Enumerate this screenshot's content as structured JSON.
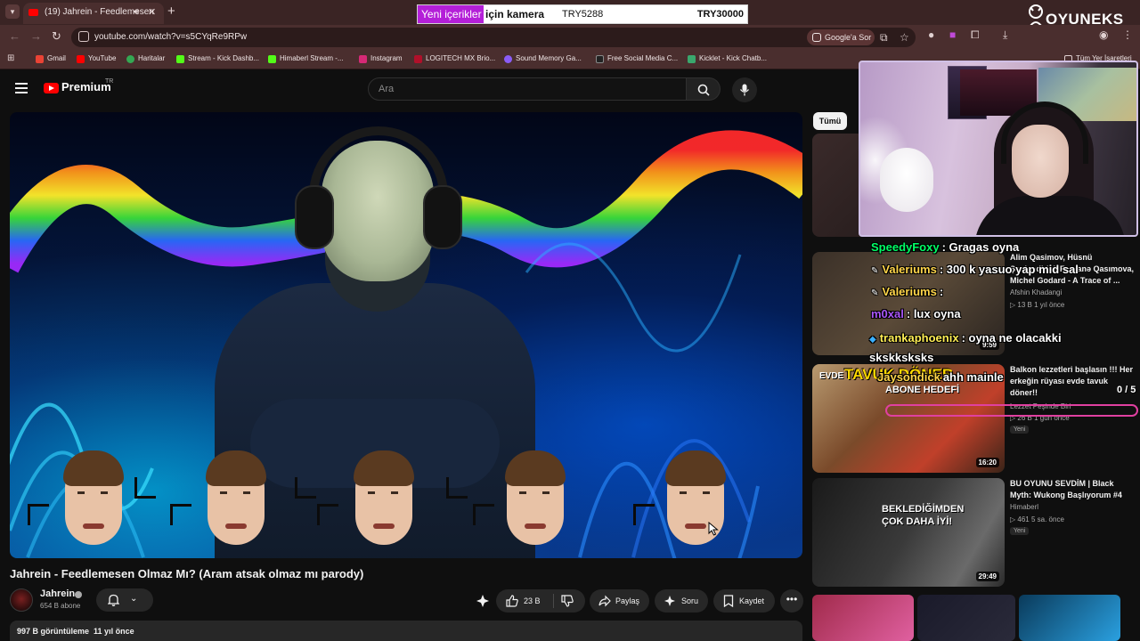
{
  "browser": {
    "tab_title": "(19) Jahrein - Feedlemesen",
    "address": "youtube.com/watch?v=s5CYqRe9RPw",
    "lens_label": "Google'a Sor",
    "bookmarks": [
      {
        "label": "Gmail",
        "color": "#ea4335"
      },
      {
        "label": "YouTube",
        "color": "#ff0000"
      },
      {
        "label": "Haritalar",
        "color": "#34a853"
      },
      {
        "label": "Stream - Kick Dashb...",
        "color": "#53fc18"
      },
      {
        "label": "Himaberl Stream -...",
        "color": "#53fc18"
      },
      {
        "label": "Instagram",
        "color": "#d62976"
      },
      {
        "label": "LOGITECH MX Brio...",
        "color": "#b0102a"
      },
      {
        "label": "Sound Memory Ga...",
        "color": "#8a5cf6"
      },
      {
        "label": "Free Social Media C...",
        "color": "#222222"
      },
      {
        "label": "Kicklet - Kick Chatb...",
        "color": "#3aa76d"
      }
    ],
    "bookmarks_other": "Tüm Yer İşaretleri"
  },
  "donation": {
    "new_content": "Yeni içerikler",
    "goal_label": "için kamera",
    "current": "TRY5288",
    "target": "TRY30000"
  },
  "logo": {
    "text": "OYUNEKS"
  },
  "youtube": {
    "brand": "Premium",
    "country": "TR",
    "search_placeholder": "Ara",
    "video": {
      "title": "Jahrein - Feedlemesen Olmaz Mı? (Aram atsak olmaz mı parody)",
      "channel": "Jahrein",
      "subscribers": "654 B abone",
      "likes": "23 B",
      "share_label": "Paylaş",
      "ask_label": "Soru",
      "save_label": "Kaydet",
      "views": "997 B görüntüleme",
      "age": "11 yıl önce"
    },
    "sidebar": {
      "chip_all": "Tümü",
      "recommendations": [
        {
          "title": "Alim Qasimov, Hüsnü Şenlendirici, Fərqanə Qasımova, Michel Godard - A Trace of ...",
          "channel": "Afshin Khadangi",
          "views": "13 B",
          "age": "1 yıl önce",
          "duration": "9:59"
        },
        {
          "title": "Balkon lezzetleri başlasın !!! Her erkeğin rüyası evde tavuk döner!!",
          "channel": "Lezzet Peşinde Biri",
          "views": "26 B",
          "age": "1 gün önce",
          "duration": "16:20",
          "badge": "Yeni",
          "thumb_text": "TAVUK DÖNER",
          "thumb_small": "EVDE"
        },
        {
          "title": "BU OYUNU SEVDİM | Black Myth: Wukong Başlıyorum #4",
          "channel": "Himaberl",
          "views": "461",
          "age": "5 sa. önce",
          "duration": "29:49",
          "badge": "Yeni",
          "thumb_text": "BEKLEDİĞİMDEN ÇOK DAHA İYİ!"
        }
      ]
    }
  },
  "chat": [
    {
      "user": "SpeedyFoxy",
      "message": ": Gragas oyna",
      "color": "#00ff66"
    },
    {
      "user": "Valeriums",
      "message": ": 300 k yasuo yap mid sal",
      "color": "#ffd54a"
    },
    {
      "user": "Valeriums",
      "message": ":",
      "color": "#ffd54a"
    },
    {
      "user": "m0xal",
      "message": ": lux oyna",
      "color": "#a855f7"
    },
    {
      "user": "trankaphoenix",
      "message": ": oyna ne olacakki skskksksks",
      "color": "#ffee55"
    },
    {
      "user": "Jaysondick",
      "message": "ahh mainle",
      "color": "#ffd54a"
    }
  ],
  "goal_overlay": {
    "label": "ABONE HEDEFİ",
    "count": "0 / 5",
    "color": "#e040a0"
  }
}
